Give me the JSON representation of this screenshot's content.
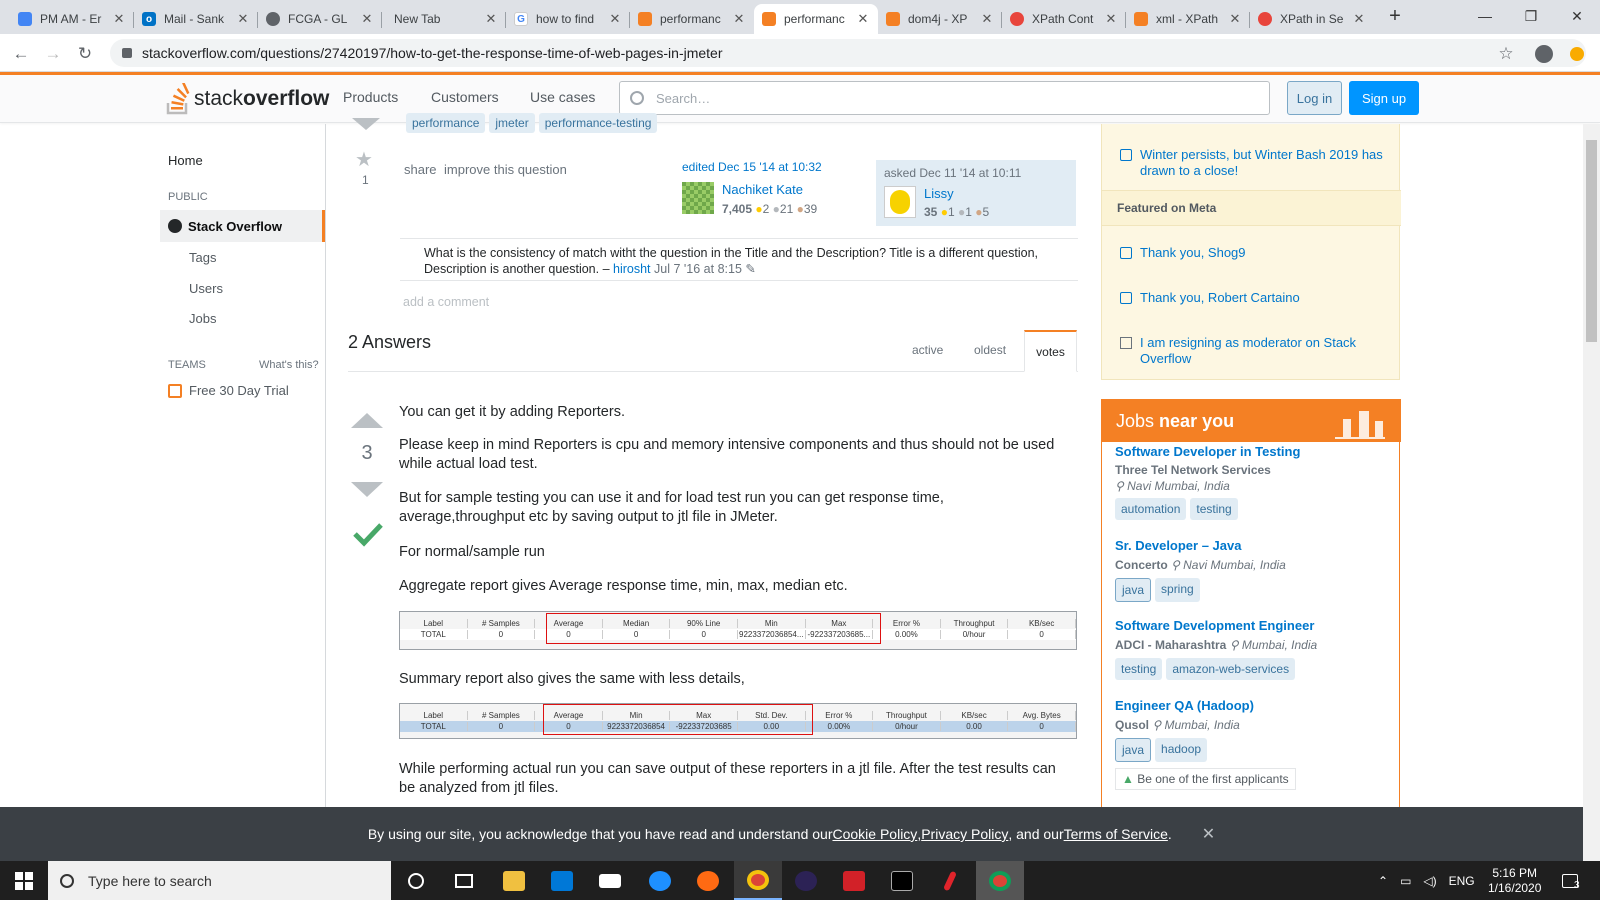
{
  "browser": {
    "tabs": [
      {
        "title": "PM AM - Er",
        "icon": "document-icon",
        "color": "#4285f4"
      },
      {
        "title": "Mail - Sank",
        "icon": "outlook-icon",
        "color": "#0072c6"
      },
      {
        "title": "FCGA - GL",
        "icon": "globe-icon",
        "color": "#5f6368"
      },
      {
        "title": "New Tab",
        "icon": "",
        "color": ""
      },
      {
        "title": "how to find",
        "icon": "google-icon",
        "color": "#4285f4"
      },
      {
        "title": "performanc",
        "icon": "stackoverflow-icon",
        "color": "#f48024"
      },
      {
        "title": "performanc",
        "icon": "stackoverflow-icon",
        "color": "#f48024"
      },
      {
        "title": "dom4j - XP",
        "icon": "stackoverflow-icon",
        "color": "#f48024"
      },
      {
        "title": "XPath Cont",
        "icon": "site-icon",
        "color": "#e8453c"
      },
      {
        "title": "xml - XPath",
        "icon": "stackoverflow-icon",
        "color": "#f48024"
      },
      {
        "title": "XPath in Se",
        "icon": "site-icon",
        "color": "#e8453c"
      }
    ],
    "url": "stackoverflow.com/questions/27420197/how-to-get-the-response-time-of-web-pages-in-jmeter",
    "minimize": "—",
    "maximize": "❐",
    "close": "✕"
  },
  "header": {
    "logo_prefix": "stack",
    "logo_bold": "overflow",
    "nav": [
      "Products",
      "Customers",
      "Use cases"
    ],
    "search_placeholder": "Search…",
    "login": "Log in",
    "signup": "Sign up"
  },
  "sidebar": {
    "home": "Home",
    "public": "PUBLIC",
    "stack_overflow": "Stack Overflow",
    "tags": "Tags",
    "users": "Users",
    "jobs": "Jobs",
    "teams": "TEAMS",
    "whats_this": "What's this?",
    "free_trial": "Free 30 Day Trial"
  },
  "question": {
    "tags": [
      "performance",
      "jmeter",
      "performance-testing"
    ],
    "fav_count": "1",
    "share": "share",
    "improve": "improve this question",
    "edited_label": "edited Dec 15 '14 at 10:32",
    "editor_name": "Nachiket Kate",
    "editor_rep": "7,405",
    "editor_gold": "2",
    "editor_silver": "21",
    "editor_bronze": "39",
    "asked_label": "asked Dec 11 '14 at 10:11",
    "asker_name": "Lissy",
    "asker_rep": "35",
    "asker_gold": "1",
    "asker_silver": "1",
    "asker_bronze": "5",
    "comment_text": "What is the consistency of match witht the question in the Title and the Description? Title is a different question, Description is another question. –",
    "comment_user": "hirosht",
    "comment_date": "Jul 7 '16 at 8:15",
    "add_comment": "add a comment"
  },
  "answers": {
    "count_label": "2 Answers",
    "sort_tabs": [
      "active",
      "oldest",
      "votes"
    ],
    "active_sort": "votes",
    "vote_count": "3",
    "paragraphs": [
      "You can get it by adding Reporters.",
      "Please keep in mind Reporters is cpu and memory intensive components and thus should not be used while actual load test.",
      "But for sample testing you can use it and for load test run you can get response time, average,throughput etc by saving output to jtl file in JMeter.",
      "For normal/sample run",
      "Aggregate report gives Average response time, min, max, median etc.",
      "Summary report also gives the same with less details,",
      "While performing actual run you can save output of these reporters in a jtl file. After the test results can be analyzed from jtl files."
    ],
    "aggregate_table": {
      "headers": [
        "Label",
        "# Samples",
        "Average",
        "Median",
        "90% Line",
        "Min",
        "Max",
        "Error %",
        "Throughput",
        "KB/sec"
      ],
      "row": [
        "TOTAL",
        "0",
        "0",
        "0",
        "0",
        "9223372036854...",
        "-922337203685...",
        "0.00%",
        "0/hour",
        "0"
      ]
    },
    "summary_table": {
      "headers": [
        "Label",
        "# Samples",
        "Average",
        "Min",
        "Max",
        "Std. Dev.",
        "Error %",
        "Throughput",
        "KB/sec",
        "Avg. Bytes"
      ],
      "row": [
        "TOTAL",
        "0",
        "0",
        "9223372036854",
        "-922337203685",
        "0.00",
        "0.00%",
        "0/hour",
        "0.00",
        "0"
      ]
    }
  },
  "meta": {
    "item1": "Winter persists, but Winter Bash 2019 has drawn to a close!",
    "featured": "Featured on Meta",
    "item2": "Thank you, Shog9",
    "item3": "Thank you, Robert Cartaino",
    "item4": "I am resigning as moderator on Stack Overflow"
  },
  "jobs": {
    "head_plain": "Jobs",
    "head_bold": "near you",
    "list": [
      {
        "title": "Software Developer in Testing",
        "company": "Three Tel Network Services",
        "location": "Navi Mumbai, India",
        "tags": [
          "automation",
          "testing"
        ]
      },
      {
        "title": "Sr. Developer – Java",
        "company": "Concerto",
        "location": "Navi Mumbai, India",
        "tags": [
          "java",
          "spring"
        ]
      },
      {
        "title": "Software Development Engineer",
        "company": "ADCI - Maharashtra",
        "location": "Mumbai, India",
        "tags": [
          "testing",
          "amazon-web-services"
        ]
      },
      {
        "title": "Engineer QA (Hadoop)",
        "company": "Qusol",
        "location": "Mumbai, India",
        "tags": [
          "java",
          "hadoop"
        ]
      }
    ],
    "first_applicants": "Be one of the first applicants"
  },
  "cookie": {
    "pre": "By using our site, you acknowledge that you have read and understand our ",
    "cookie_policy": "Cookie Policy",
    "sep1": ", ",
    "privacy_policy": "Privacy Policy",
    "sep2": ", and our ",
    "terms": "Terms of Service",
    "post": "."
  },
  "taskbar": {
    "search_placeholder": "Type here to search",
    "lang": "ENG",
    "time": "5:16 PM",
    "date": "1/16/2020",
    "notifications": "3"
  }
}
